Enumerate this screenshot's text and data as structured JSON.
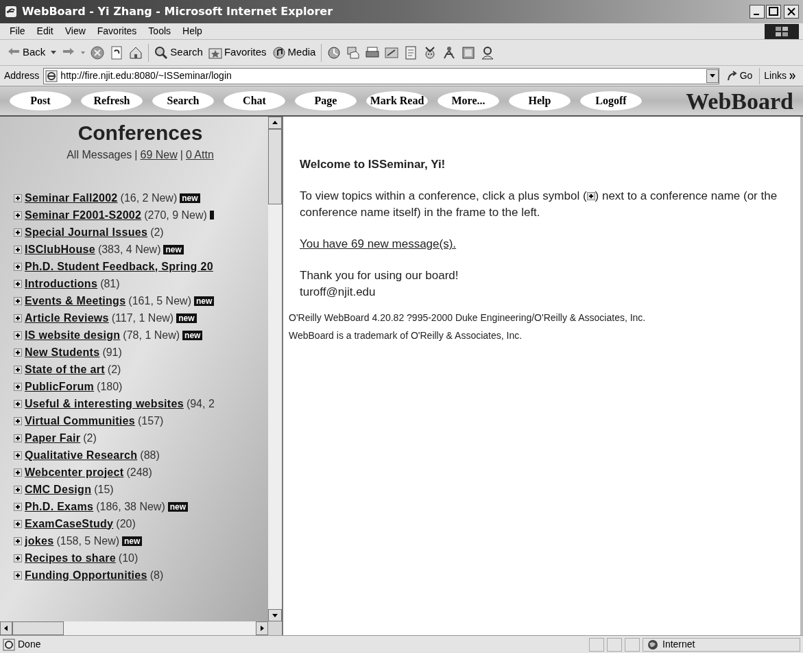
{
  "window": {
    "title": "WebBoard - Yi Zhang - Microsoft Internet Explorer"
  },
  "menu": [
    "File",
    "Edit",
    "View",
    "Favorites",
    "Tools",
    "Help"
  ],
  "toolbar": [
    {
      "kind": "back",
      "label": "Back"
    },
    {
      "kind": "forward"
    },
    {
      "kind": "stop"
    },
    {
      "kind": "refresh"
    },
    {
      "kind": "home"
    },
    {
      "kind": "search",
      "label": "Search"
    },
    {
      "kind": "favorites",
      "label": "Favorites"
    },
    {
      "kind": "media",
      "label": "Media"
    },
    {
      "kind": "history"
    },
    {
      "kind": "mail"
    },
    {
      "kind": "print"
    },
    {
      "kind": "edit"
    },
    {
      "kind": "discuss"
    },
    {
      "kind": "messenger"
    },
    {
      "kind": "buddy"
    },
    {
      "kind": "research"
    },
    {
      "kind": "person"
    }
  ],
  "address": {
    "label": "Address",
    "url": "http://fire.njit.edu:8080/~ISSeminar/login",
    "go": "Go",
    "links": "Links"
  },
  "nav": {
    "buttons": [
      "Post",
      "Refresh",
      "Search",
      "Chat",
      "Page",
      "Mark Read",
      "More...",
      "Help",
      "Logoff"
    ],
    "logo": "WebBoard"
  },
  "conferences": {
    "title": "Conferences",
    "all": "All Messages",
    "separator": "|",
    "new_link": "69 New",
    "attn_link": "0 Attn",
    "items": [
      {
        "name": "Seminar Fall2002",
        "count": "(16, 2 New)",
        "badge": "new"
      },
      {
        "name": "Seminar F2001-S2002",
        "count": "(270, 9 New)",
        "badge_clipped": true
      },
      {
        "name": "Special Journal Issues",
        "count": "(2)"
      },
      {
        "name": "ISClubHouse",
        "count": "(383, 4 New)",
        "badge": "new"
      },
      {
        "name": "Ph.D. Student Feedback, Spring 20"
      },
      {
        "name": "Introductions",
        "count": "(81)"
      },
      {
        "name": "Events & Meetings",
        "count": "(161, 5 New)",
        "badge": "new"
      },
      {
        "name": "Article Reviews",
        "count": "(117, 1 New)",
        "badge": "new"
      },
      {
        "name": "IS website design",
        "count": "(78, 1 New)",
        "badge": "new"
      },
      {
        "name": "New Students",
        "count": "(91)"
      },
      {
        "name": "State of the art",
        "count": "(2)"
      },
      {
        "name": "PublicForum",
        "count": "(180)"
      },
      {
        "name": "Useful & interesting websites",
        "count": "(94, 2"
      },
      {
        "name": "Virtual Communities",
        "count": "(157)"
      },
      {
        "name": "Paper Fair",
        "count": "(2)"
      },
      {
        "name": "Qualitative Research",
        "count": "(88)"
      },
      {
        "name": "Webcenter project",
        "count": "(248)"
      },
      {
        "name": "CMC Design",
        "count": "(15)"
      },
      {
        "name": "Ph.D. Exams",
        "count": "(186, 38 New)",
        "badge": "new"
      },
      {
        "name": "ExamCaseStudy",
        "count": "(20)"
      },
      {
        "name": "jokes",
        "count": "(158, 5 New)",
        "badge": "new"
      },
      {
        "name": "Recipes to share",
        "count": "(10)"
      },
      {
        "name": "Funding Opportunities",
        "count": "(8)"
      }
    ]
  },
  "main": {
    "welcome": "Welcome to ISSeminar, Yi!",
    "intro_before": "To view topics within a conference, click a plus symbol (",
    "intro_after": ") next to a conference name (or the conference name itself) in the frame to the left.",
    "new_messages": "You have 69 new message(s).",
    "thanks": "Thank you for using our board!",
    "email": "turoff@njit.edu",
    "copyright": "O'Reilly WebBoard 4.20.82 ?995-2000 Duke Engineering/O'Reilly & Associates, Inc.",
    "trademark": "WebBoard is a trademark of O'Reilly & Associates, Inc."
  },
  "status_bar": {
    "text": "Done",
    "zone": "Internet"
  }
}
